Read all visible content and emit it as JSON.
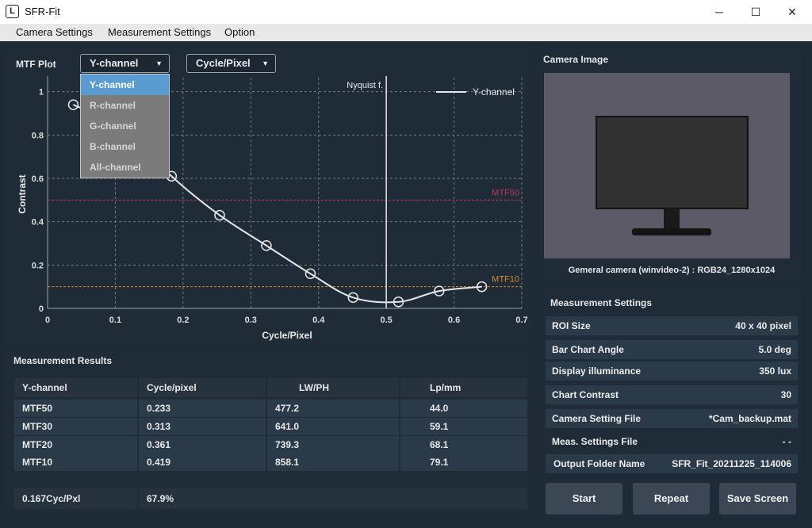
{
  "window": {
    "app_icon": "L",
    "title": "SFR-Fit",
    "minimize": "─",
    "maximize": "☐",
    "close": "✕"
  },
  "menu": [
    "Camera Settings",
    "Measurement Settings",
    "Option"
  ],
  "plot": {
    "title": "MTF Plot",
    "channel_dropdown": "Y-channel",
    "unit_dropdown": "Cycle/Pixel",
    "dropdown_arrow": "▼",
    "channel_options": [
      "Y-channel",
      "R-channel",
      "G-channel",
      "B-channel",
      "All-channel"
    ],
    "selected_option": 0
  },
  "chart_data": {
    "type": "line",
    "xlabel": "Cycle/Pixel",
    "ylabel": "Contrast",
    "xlim": [
      0,
      0.7
    ],
    "ylim": [
      0,
      1.05
    ],
    "xticks": [
      0,
      0.1,
      0.2,
      0.3,
      0.4,
      0.5,
      0.6,
      0.7
    ],
    "xtick_labels": [
      "0",
      "0.1",
      "0.2",
      "0.3",
      "0.4",
      "0.5",
      "0.6",
      "0.7"
    ],
    "yticks": [
      0,
      0.2,
      0.4,
      0.6,
      0.8,
      1
    ],
    "ytick_labels": [
      "0",
      "0.2",
      "0.4",
      "0.6",
      "0.8",
      "1"
    ],
    "grid": true,
    "legend": "top-right",
    "series": [
      {
        "name": "Y-channel",
        "color": "#e6e6e6",
        "x": [
          0.038,
          0.118,
          0.183,
          0.254,
          0.323,
          0.388,
          0.451,
          0.518,
          0.578,
          0.641
        ],
        "y": [
          0.94,
          0.82,
          0.61,
          0.43,
          0.29,
          0.16,
          0.05,
          0.03,
          0.08,
          0.1
        ]
      }
    ],
    "vlines": [
      {
        "x": 0.5,
        "label": "Nyquist f.",
        "color": "#e6e6e6"
      }
    ],
    "hlines": [
      {
        "y": 0.5,
        "label": "MTF50",
        "color": "#b8385a"
      },
      {
        "y": 0.1,
        "label": "MTF10",
        "color": "#d38a2a"
      }
    ]
  },
  "results": {
    "title": "Measurement Results",
    "headers": [
      "Y-channel",
      "Cycle/pixel",
      "LW/PH",
      "Lp/mm"
    ],
    "rows": [
      [
        "MTF50",
        "0.233",
        "477.2",
        "44.0"
      ],
      [
        "MTF30",
        "0.313",
        "641.0",
        "59.1"
      ],
      [
        "MTF20",
        "0.361",
        "739.3",
        "68.1"
      ],
      [
        "MTF10",
        "0.419",
        "858.1",
        "79.1"
      ]
    ],
    "summary": [
      "0.167Cyc/Pxl",
      "67.9%"
    ]
  },
  "camera": {
    "title": "Camera Image",
    "caption": "Gemeral camera (winvideo-2) : RGB24_1280x1024"
  },
  "settings": {
    "title": "Measurement Settings",
    "rows": [
      {
        "label": "ROI Size",
        "value": "40 x 40 pixel"
      },
      {
        "label": "Bar Chart Angle",
        "value": "5.0 deg"
      },
      {
        "label": "Display illuminance",
        "value": "350 lux"
      },
      {
        "label": "Chart Contrast",
        "value": "30"
      },
      {
        "label": "Camera Setting File",
        "value": "*Cam_backup.mat"
      },
      {
        "label": "Meas. Settings File",
        "value": "- -"
      },
      {
        "label": "Output Folder Name",
        "value": "SFR_Fit_20211225_114006"
      }
    ]
  },
  "buttons": [
    "Start",
    "Repeat",
    "Save Screen"
  ],
  "colors": {
    "panel": "#1f2c38",
    "dropdown_selected": "#5a9ccf",
    "mtf50": "#b8385a",
    "mtf10": "#d38a2a"
  }
}
